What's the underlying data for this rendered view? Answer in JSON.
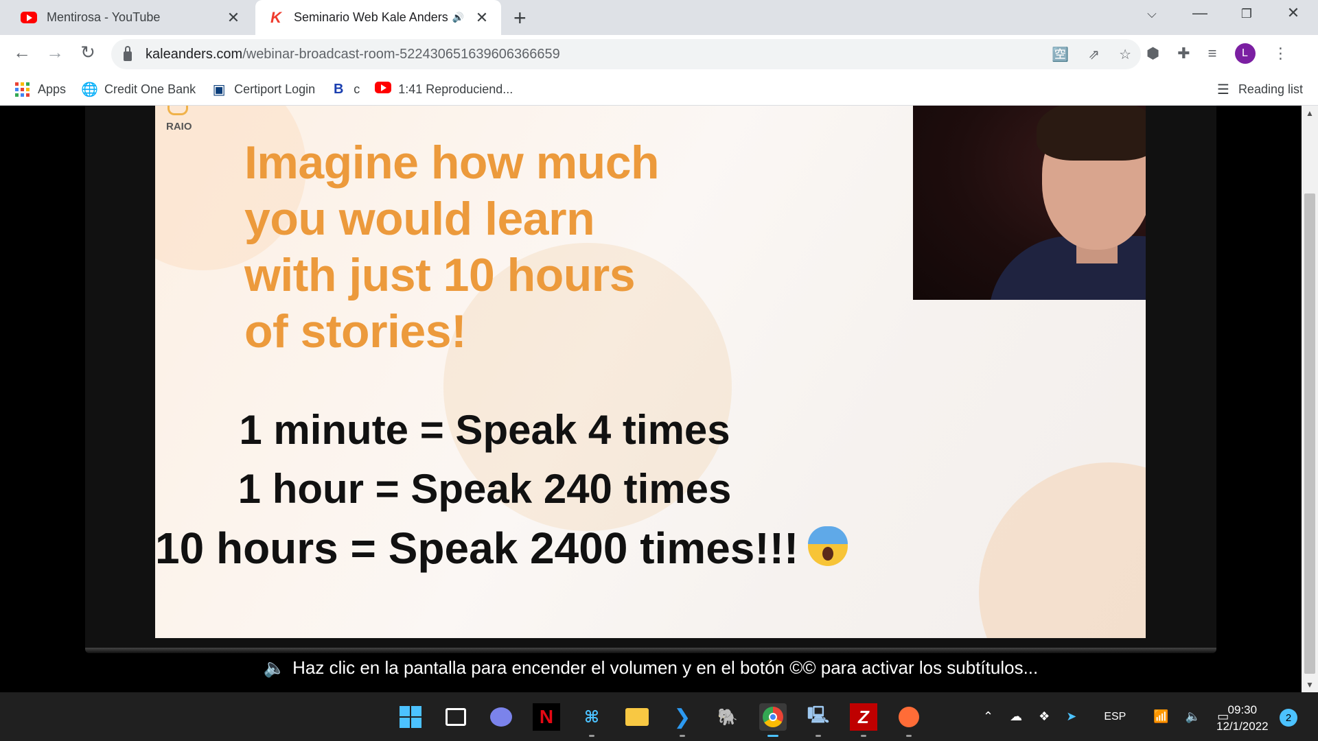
{
  "browser": {
    "tabs": [
      {
        "title": "Mentirosa - YouTube",
        "favicon": "youtube-icon",
        "active": false
      },
      {
        "title": "Seminario Web Kale Anders",
        "favicon": "kale-anders-icon",
        "active": true,
        "audio": true
      }
    ],
    "new_tab_label": "+",
    "url_host": "kaleanders.com",
    "url_path": "/webinar-broadcast-room-5224306516396063666​59",
    "bookmarks": [
      {
        "label": "Apps",
        "icon": "apps-grid-icon"
      },
      {
        "label": "Credit One Bank",
        "icon": "globe-icon"
      },
      {
        "label": "Certiport Login",
        "icon": "certiport-icon"
      },
      {
        "label": "c",
        "icon": "b-icon"
      },
      {
        "label": "1:41 Reproduciend...",
        "icon": "youtube-icon"
      }
    ],
    "reading_list": "Reading list",
    "profile_initial": "L"
  },
  "slide": {
    "brand": "RAIO",
    "headline_lines": [
      "Imagine how much",
      "you would learn",
      "with just 10 hours",
      "of stories!"
    ],
    "facts": [
      "1 minute = Speak 4 times",
      "1 hour = Speak 240 times",
      "10 hours = Speak 2400 times!!!"
    ],
    "accent_color": "#ec9a3c"
  },
  "hint_text": "Haz clic en la pantalla para encender el volumen y en el botón ©© para activar los subtítulos...",
  "taskbar": {
    "apps": [
      "windows-start-icon",
      "task-view-icon",
      "teams-chat-icon",
      "netflix-icon",
      "network-app-icon",
      "file-explorer-icon",
      "vscode-icon",
      "postgres-icon",
      "chrome-icon",
      "remote-desktop-icon",
      "filezilla-icon",
      "postman-icon"
    ],
    "language": "ESP",
    "time": "09:30",
    "date": "12/1/2022",
    "notifications": "2"
  }
}
